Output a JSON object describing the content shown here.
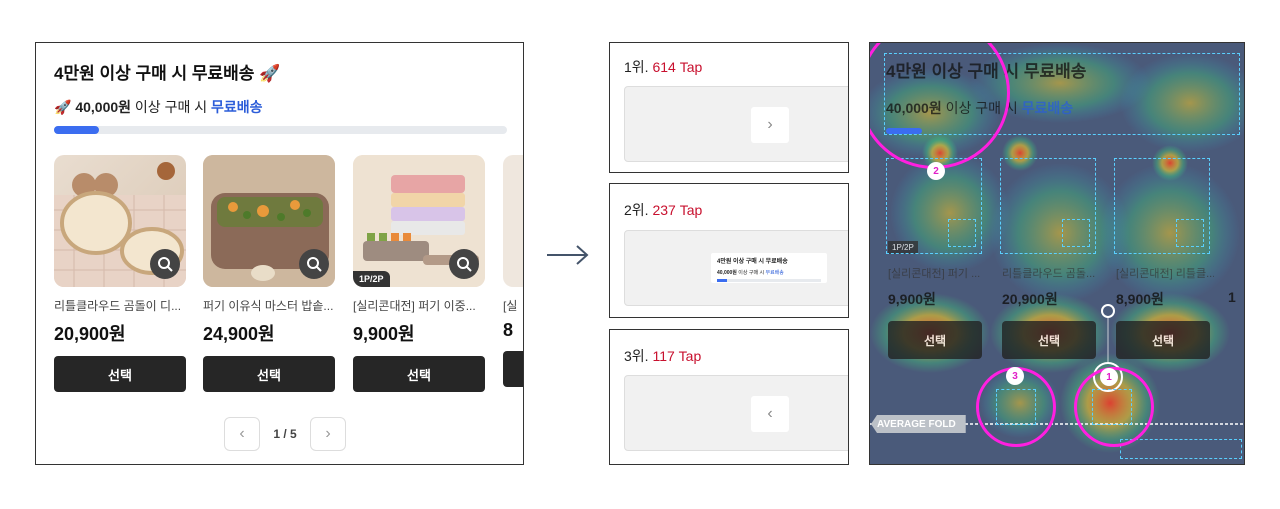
{
  "card": {
    "title": "4만원 이상 구매 시 무료배송 🚀",
    "sub_prefix": "🚀 ",
    "sub_amount": "40,000원",
    "sub_middle": " 이상 구매 시 ",
    "sub_highlight": "무료배송",
    "progress_fraction": 0.1,
    "products": [
      {
        "name": "리틀클라우드 곰돌이 디...",
        "price": "20,900원",
        "button": "선택",
        "tag": ""
      },
      {
        "name": "퍼기 이유식 마스터 밥솥...",
        "price": "24,900원",
        "button": "선택",
        "tag": ""
      },
      {
        "name": "[실리콘대전] 퍼기 이중...",
        "price": "9,900원",
        "button": "선택",
        "tag": "1P/2P"
      },
      {
        "name": "[실",
        "price": "8",
        "button": "",
        "tag": ""
      }
    ],
    "pager": {
      "prev": "‹",
      "page": "1 / 5",
      "next": "›"
    }
  },
  "ranks": [
    {
      "rank": "1위.",
      "count": "614 Tap"
    },
    {
      "rank": "2위.",
      "count": "237 Tap"
    },
    {
      "rank": "3위.",
      "count": "117 Tap"
    }
  ],
  "rank2_preview": {
    "title": "4만원 이상 구매 시 무료배송",
    "sub_amount": "40,000원",
    "sub_middle": " 이상 구매 시 ",
    "sub_highlight": "무료배송"
  },
  "heatmap": {
    "title": "4만원 이상 구매 시 무료배송",
    "sub_amount": "40,000원",
    "sub_middle": " 이상 구매 시 ",
    "sub_highlight": "무료배송",
    "tag": "1P/2P",
    "names": [
      "[실리콘대전] 퍼기 ...",
      "리틀클라우드 곰돌...",
      "[실리콘대전] 리틀클..."
    ],
    "prices": [
      "9,900원",
      "20,900원",
      "8,900원",
      "1"
    ],
    "button": "선택",
    "fold_label": "AVERAGE FOLD",
    "markers": [
      "1",
      "2",
      "3"
    ]
  },
  "colors": {
    "accent_blue": "#2b5cd9",
    "rank_red": "#c8102e",
    "highlight": "#ff1fe0",
    "dash": "#5ad0ff"
  }
}
